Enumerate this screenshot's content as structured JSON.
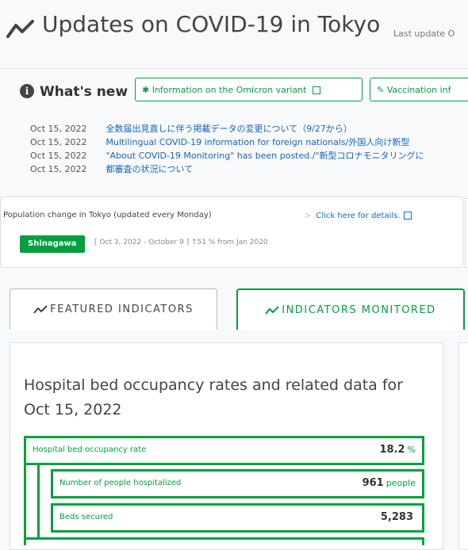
{
  "header": {
    "title": "Updates on COVID-19 in Tokyo",
    "last_update": "Last update O"
  },
  "whats_new": {
    "title": "What's new",
    "buttons": [
      {
        "icon": "asterisk-icon",
        "label": "Information on the Omicron variant"
      },
      {
        "icon": "syringe-icon",
        "label": "Vaccination inf"
      }
    ],
    "items": [
      {
        "date": "Oct 15, 2022",
        "text": "全数届出見直しに伴う掲載データの変更について（9/27から）"
      },
      {
        "date": "Oct 15, 2022",
        "text": "Multilingual COVID-19 information for foreign nationals/外国人向け新型"
      },
      {
        "date": "Oct 15, 2022",
        "text": "\"About COVID-19 Monitoring\" has been posted./\"新型コロナモニタリングに"
      },
      {
        "date": "Oct 15, 2022",
        "text": "都審査の状況について"
      }
    ]
  },
  "population": {
    "title": "Population change in Tokyo (updated every Monday)",
    "details_link": "Click here for details.",
    "badge": "Shinagawa",
    "period": "[ Oct 3, 2022 - October 9 ] ↑51 % from Jan 2020"
  },
  "tabs": [
    {
      "label": "FEATURED INDICATORS",
      "selected": true
    },
    {
      "label": "INDICATORS MONITORED",
      "selected": false
    }
  ],
  "card": {
    "title": "Hospital bed occupancy rates and related data for Oct 15, 2022",
    "rows": [
      {
        "label": "Hospital bed occupancy rate",
        "value": "18.2",
        "unit": "%"
      },
      {
        "label": "Number of people hospitalized",
        "value": "961",
        "unit": "people"
      },
      {
        "label": "Beds secured",
        "value": "5,283",
        "unit": ""
      }
    ]
  },
  "colors": {
    "accent": "#00a040",
    "link": "#1565c0"
  }
}
